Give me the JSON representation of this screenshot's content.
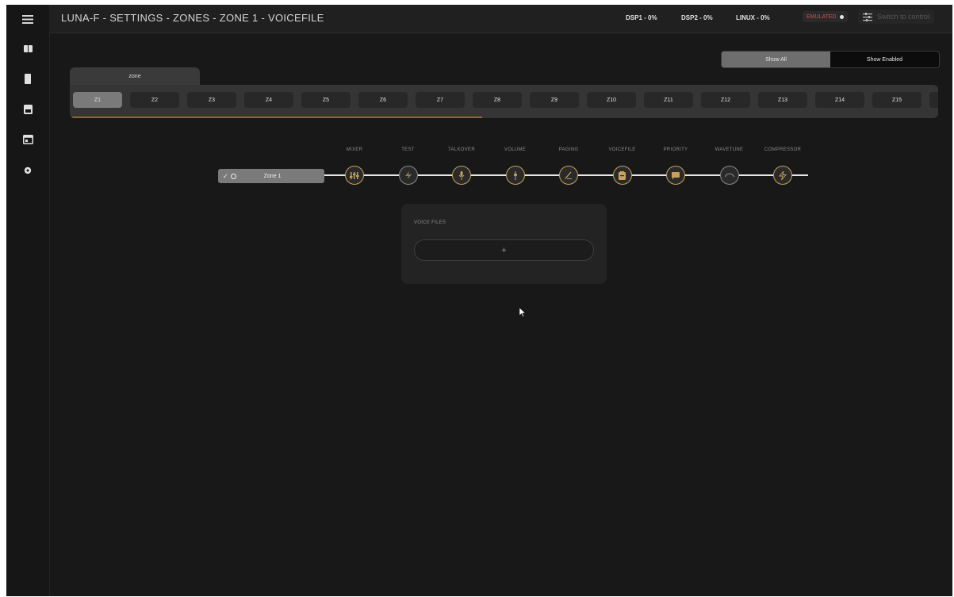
{
  "breadcrumb": "LUNA-F - SETTINGS - ZONES - ZONE 1 - VOICEFILE",
  "status": {
    "dsp1": "DSP1 - 0%",
    "dsp2": "DSP2 - 0%",
    "linux": "LINUX - 0%",
    "emulated": "EMULATED",
    "switch_to_control": "Switch to control"
  },
  "sidebar": {
    "items": [
      {
        "icon": "menu-icon"
      },
      {
        "icon": "grid-icon"
      },
      {
        "icon": "device-icon"
      },
      {
        "icon": "storage-icon"
      },
      {
        "icon": "calendar-icon"
      },
      {
        "icon": "settings-icon"
      }
    ]
  },
  "filter": {
    "show_all": "Show All",
    "show_enabled": "Show Enabled",
    "selected": "Show All"
  },
  "zone_group": {
    "tab_label": "zone",
    "zones": [
      "Z1",
      "Z2",
      "Z3",
      "Z4",
      "Z5",
      "Z6",
      "Z7",
      "Z8",
      "Z9",
      "Z10",
      "Z11",
      "Z12",
      "Z13",
      "Z14",
      "Z15"
    ],
    "selected": "Z1"
  },
  "pipeline": {
    "zone_name": "Zone 1",
    "stages": [
      {
        "label": "MIXER",
        "icon": "mixer-icon"
      },
      {
        "label": "TEST",
        "icon": "bolt-icon"
      },
      {
        "label": "TALKOVER",
        "icon": "microphone-icon"
      },
      {
        "label": "VOLUME",
        "icon": "volume-icon"
      },
      {
        "label": "PAGING",
        "icon": "pen-icon"
      },
      {
        "label": "VOICEFILE",
        "icon": "file-icon"
      },
      {
        "label": "PRIORITY",
        "icon": "flag-icon"
      },
      {
        "label": "WAVETUNE",
        "icon": "wave-icon"
      },
      {
        "label": "COMPRESSOR",
        "icon": "lightning-icon"
      }
    ]
  },
  "voice_files": {
    "title": "VOICE FILES",
    "add_label": "+"
  },
  "colors": {
    "background": "#181818",
    "accent_gold": "#c8a25a",
    "emulated_red": "#d05050"
  }
}
